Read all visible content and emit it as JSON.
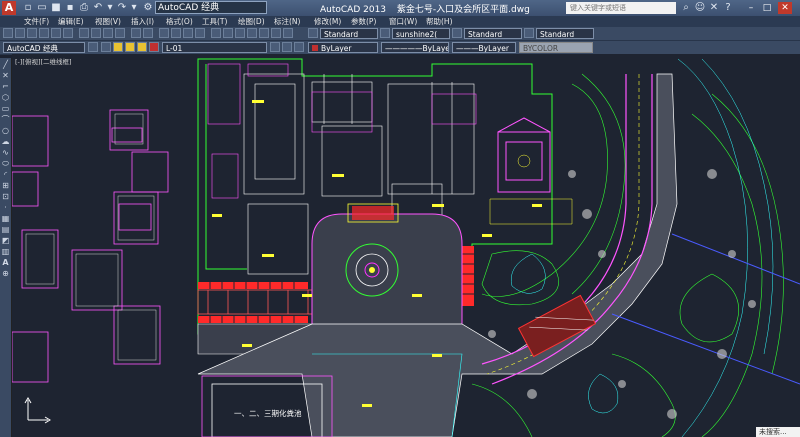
{
  "titlebar": {
    "logo_letter": "A",
    "workspace": "AutoCAD 经典",
    "app_name": "AutoCAD 2013",
    "document": "紫金七号-入口及会所区平面.dwg",
    "search_placeholder": "键入关键字或短语",
    "minimize": "–",
    "maximize": "□",
    "close": "✕"
  },
  "menubar": {
    "items": [
      "文件(F)",
      "编辑(E)",
      "视图(V)",
      "插入(I)",
      "格式(O)",
      "工具(T)",
      "绘图(D)",
      "标注(N)",
      "修改(M)",
      "参数(P)",
      "窗口(W)",
      "帮助(H)"
    ]
  },
  "toolbar": {
    "text_style": "Standard",
    "dim_style": "sunshine2(",
    "table_style": "Standard",
    "multileader_style": "Standard",
    "workspace": "AutoCAD 经典",
    "layer": "L-01",
    "color": "ByLayer",
    "linetype": "ByLayer",
    "lineweight": "ByLayer",
    "plotstyle": "BYCOLOR"
  },
  "canvas": {
    "viewport_label": "[-][俯视][二维线框]",
    "plan_annotation": "一、二、三期化粪池"
  },
  "status": {
    "user_badge": "未搜索..."
  },
  "colors": {
    "canvas_bg": "#1e2431",
    "cad_green": "#33ff33",
    "cad_magenta": "#ff33ff",
    "cad_red": "#ff3333",
    "cad_yellow": "#ffff33",
    "cad_cyan": "#33ffff",
    "cad_white": "#ffffff",
    "cad_blue": "#4a5bff"
  }
}
